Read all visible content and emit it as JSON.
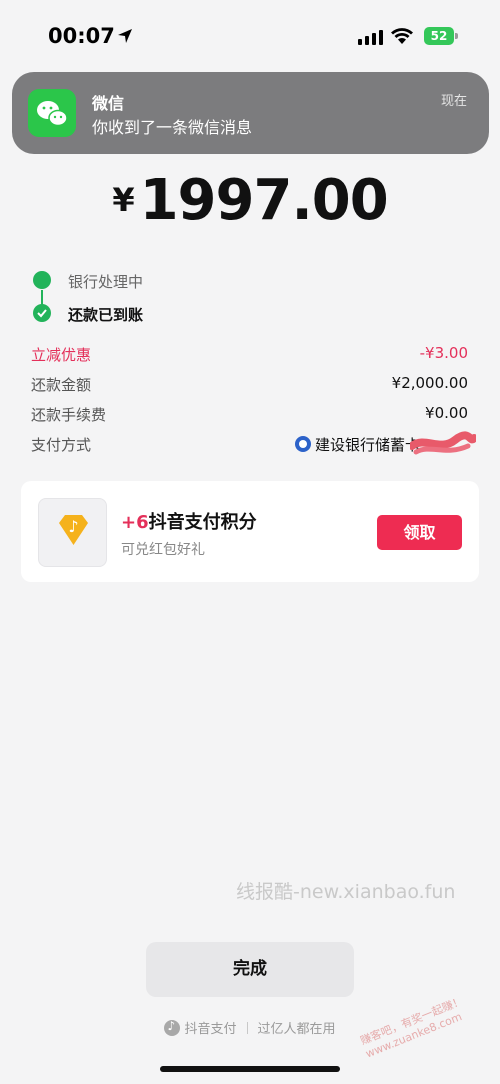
{
  "status_bar": {
    "time": "00:07",
    "battery": "52"
  },
  "notification": {
    "app": "微信",
    "message": "你收到了一条微信消息",
    "time": "现在"
  },
  "amount": {
    "currency": "¥",
    "value": "1997.00"
  },
  "progress": {
    "step1": "银行处理中",
    "step2": "还款已到账"
  },
  "details": {
    "discount_label": "立减优惠",
    "discount_value": "-¥3.00",
    "repay_label": "还款金额",
    "repay_value": "¥2,000.00",
    "fee_label": "还款手续费",
    "fee_value": "¥0.00",
    "pay_label": "支付方式",
    "pay_value": "建设银行储蓄卡"
  },
  "reward": {
    "plus": "+6",
    "title": "抖音支付积分",
    "subtitle": "可兑红包好礼",
    "button": "领取"
  },
  "watermark": "线报酷-new.xianbao.fun",
  "done_button": "完成",
  "footer": {
    "brand": "抖音支付",
    "slogan": "过亿人都在用"
  },
  "stamp": "赚客吧，有奖一起赚！ www.zuanke8.com",
  "colors": {
    "accent_red": "#ee2c52",
    "success_green": "#22b35a",
    "wechat_green": "#2bc64a"
  }
}
